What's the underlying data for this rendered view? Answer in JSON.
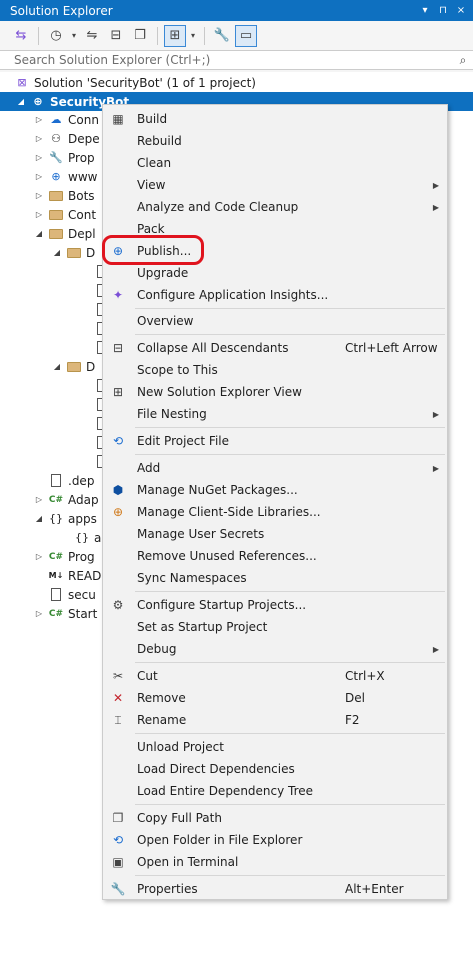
{
  "titlebar": {
    "title": "Solution Explorer",
    "pin": "▾",
    "pin2": "⊓",
    "close": "×"
  },
  "toolbar": {
    "icons": [
      "vs-switch-icon",
      "history-icon",
      "sync-icon",
      "collapse-icon",
      "show-all-files-icon",
      "preview-icon",
      "properties-icon",
      "pending-changes-icon"
    ]
  },
  "search": {
    "placeholder": "Search Solution Explorer (Ctrl+;)",
    "icon": "search-icon"
  },
  "tree": {
    "solution": "Solution 'SecurityBot' (1 of 1 project)",
    "project": "SecurityBot",
    "items": [
      {
        "label": "Conn"
      },
      {
        "label": "Depe"
      },
      {
        "label": "Prop"
      },
      {
        "label": "www"
      },
      {
        "label": "Bots"
      },
      {
        "label": "Cont"
      },
      {
        "label": "Depl"
      },
      {
        "label": "D"
      },
      {
        "label": "D"
      },
      {
        "label": ".dep"
      },
      {
        "label": "Adap"
      },
      {
        "label": "apps"
      },
      {
        "label": "a"
      },
      {
        "label": "Prog"
      },
      {
        "label": "READ"
      },
      {
        "label": "secu"
      },
      {
        "label": "Start"
      }
    ]
  },
  "menu": {
    "items": [
      {
        "label": "Build"
      },
      {
        "label": "Rebuild"
      },
      {
        "label": "Clean"
      },
      {
        "label": "View"
      },
      {
        "label": "Analyze and Code Cleanup"
      },
      {
        "label": "Pack"
      },
      {
        "label": "Publish..."
      },
      {
        "label": "Upgrade"
      },
      {
        "label": "Configure Application Insights..."
      },
      {
        "label": "Overview"
      },
      {
        "label": "Collapse All Descendants",
        "shortcut": "Ctrl+Left Arrow"
      },
      {
        "label": "Scope to This"
      },
      {
        "label": "New Solution Explorer View"
      },
      {
        "label": "File Nesting"
      },
      {
        "label": "Edit Project File"
      },
      {
        "label": "Add"
      },
      {
        "label": "Manage NuGet Packages..."
      },
      {
        "label": "Manage Client-Side Libraries..."
      },
      {
        "label": "Manage User Secrets"
      },
      {
        "label": "Remove Unused References..."
      },
      {
        "label": "Sync Namespaces"
      },
      {
        "label": "Configure Startup Projects..."
      },
      {
        "label": "Set as Startup Project"
      },
      {
        "label": "Debug"
      },
      {
        "label": "Cut",
        "shortcut": "Ctrl+X"
      },
      {
        "label": "Remove",
        "shortcut": "Del"
      },
      {
        "label": "Rename",
        "shortcut": "F2"
      },
      {
        "label": "Unload Project"
      },
      {
        "label": "Load Direct Dependencies"
      },
      {
        "label": "Load Entire Dependency Tree"
      },
      {
        "label": "Copy Full Path"
      },
      {
        "label": "Open Folder in File Explorer"
      },
      {
        "label": "Open in Terminal"
      },
      {
        "label": "Properties",
        "shortcut": "Alt+Enter"
      }
    ]
  }
}
